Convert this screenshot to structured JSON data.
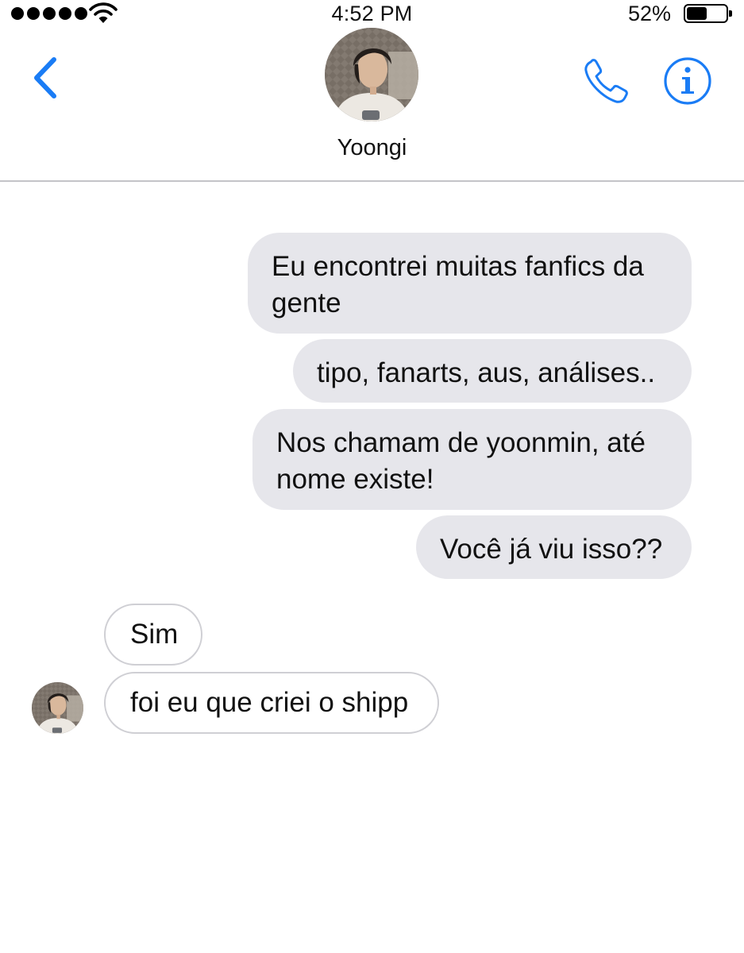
{
  "status_bar": {
    "time": "4:52 PM",
    "battery_percent": "52%",
    "battery_level": 0.52,
    "signal_icon": "signal-dots-icon",
    "wifi_icon": "wifi-icon"
  },
  "header": {
    "contact_name": "Yoongi",
    "back_icon": "chevron-left-icon",
    "call_icon": "phone-icon",
    "info_icon": "info-icon",
    "accent_color": "#1a7cf5"
  },
  "messages": [
    {
      "direction": "outgoing",
      "text": "Eu encontrei muitas fanfics da gente"
    },
    {
      "direction": "outgoing",
      "text": "tipo, fanarts, aus, análises.."
    },
    {
      "direction": "outgoing",
      "text": "Nos chamam de yoonmin, até nome existe!"
    },
    {
      "direction": "outgoing",
      "text": "Você já viu isso??"
    },
    {
      "direction": "incoming",
      "text": "Sim"
    },
    {
      "direction": "incoming",
      "text": "foi eu que criei o shipp"
    }
  ],
  "colors": {
    "outgoing_bubble": "#e6e6eb",
    "incoming_bubble_border": "#cfcfd4",
    "divider": "#c4c4c8"
  }
}
